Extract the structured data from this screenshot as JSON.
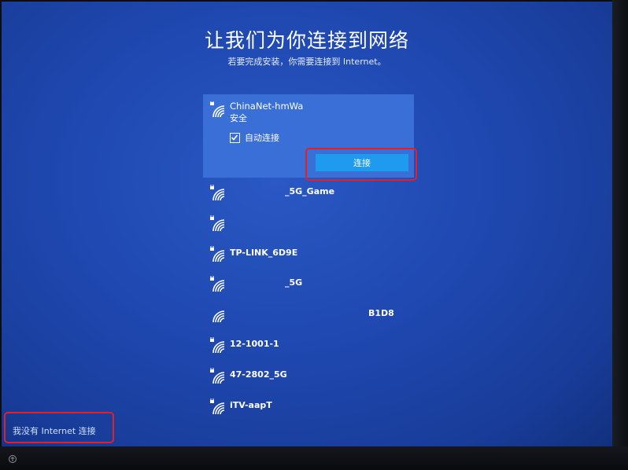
{
  "page": {
    "title": "让我们为你连接到网络",
    "subtitle": "若要完成安装，你需要连接到 Internet。"
  },
  "networks": {
    "selected": {
      "name": "ChinaNet-hmWa",
      "status": "安全",
      "auto_connect_label": "自动连接",
      "auto_connect_checked": true,
      "connect_label": "连接"
    },
    "items": [
      {
        "name": "_5G_Game",
        "secured": true
      },
      {
        "name": "",
        "secured": true
      },
      {
        "name": "TP-LINK_6D9E",
        "secured": true
      },
      {
        "name": "_5G",
        "secured": true
      },
      {
        "name": "B1D8",
        "secured": false
      },
      {
        "name": "12-1001-1",
        "secured": true
      },
      {
        "name": "47-2802_5G",
        "secured": true
      },
      {
        "name": "iTV-aapT",
        "secured": true
      }
    ]
  },
  "footer": {
    "no_internet_label": "我没有 Internet 连接"
  },
  "colors": {
    "selected_bg": "#3a6fd8",
    "button": "#1e9bef",
    "highlight": "#e0202b"
  },
  "icons": {
    "network": "wifi-secured-icon",
    "open_network": "wifi-icon",
    "accessibility": "accessibility-icon"
  }
}
